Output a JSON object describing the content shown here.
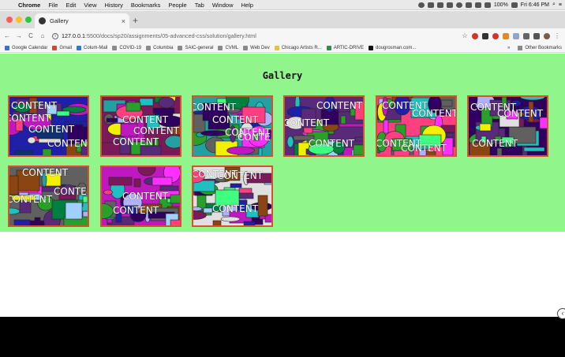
{
  "menubar": {
    "app": "Chrome",
    "items": [
      "File",
      "Edit",
      "View",
      "History",
      "Bookmarks",
      "People",
      "Tab",
      "Window",
      "Help"
    ],
    "battery": "100%",
    "clock": "Fri 6:46 PM"
  },
  "tab": {
    "title": "Gallery",
    "close": "×",
    "new_tab": "+"
  },
  "toolbar": {
    "back": "←",
    "forward": "→",
    "reload": "C",
    "home": "⌂",
    "url_host": "127.0.0.1",
    "url_path": ":5500/docs/sp20/assignments/05-advanced-css/solution/gallery.html",
    "star": "☆"
  },
  "bookmarks": {
    "items": [
      "Google Calendar",
      "Gmail",
      "Colum-Mail",
      "COVID-19",
      "Columbia",
      "SAIC-general",
      "CVML",
      "Web Dev",
      "Chicago Artists R...",
      "ARTIC-DRIVE",
      "dougrosman.com..."
    ],
    "more": "»",
    "other": "Other Bookmarks"
  },
  "page": {
    "heading": "Gallery",
    "thumb_label": "CONTENT",
    "thumbnails": [
      {
        "name": "gallery-image-1"
      },
      {
        "name": "gallery-image-2"
      },
      {
        "name": "gallery-image-3"
      },
      {
        "name": "gallery-image-4"
      },
      {
        "name": "gallery-image-5"
      },
      {
        "name": "gallery-image-6"
      },
      {
        "name": "gallery-image-7"
      },
      {
        "name": "gallery-image-8"
      },
      {
        "name": "gallery-image-9"
      }
    ]
  },
  "colors": {
    "page_background": "#90f58a",
    "thumbnail_border": "#d9512a",
    "bottom_bar": "#000000"
  },
  "scroll_indicator": "‹"
}
